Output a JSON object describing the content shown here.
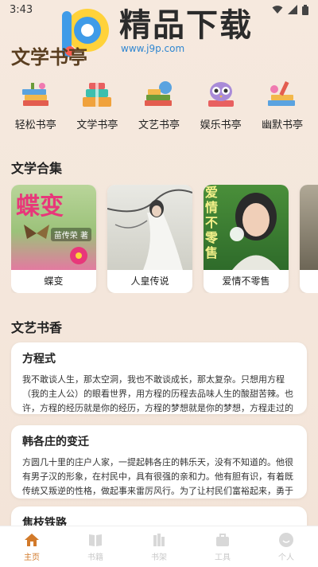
{
  "status": {
    "time": "3:43"
  },
  "watermark": {
    "title": "精品下载",
    "url": "www.j9p.com"
  },
  "page": {
    "title": "文学书亭"
  },
  "categories": [
    {
      "label": "轻松书亭",
      "icon": "books-stack-icon"
    },
    {
      "label": "文学书亭",
      "icon": "book-bundle-icon"
    },
    {
      "label": "文艺书亭",
      "icon": "globe-books-icon"
    },
    {
      "label": "娱乐书亭",
      "icon": "owl-books-icon"
    },
    {
      "label": "幽默书亭",
      "icon": "pencil-books-icon"
    }
  ],
  "sections": {
    "collection_title": "文学合集",
    "articles_title": "文艺书香"
  },
  "books": [
    {
      "name": "蝶变",
      "cover_title": "蝶变",
      "cover_author": "苗传荣 著"
    },
    {
      "name": "人皇传说"
    },
    {
      "name": "爱情不零售",
      "cover_text": "爱情不零售"
    },
    {
      "name": ""
    }
  ],
  "articles": [
    {
      "title": "方程式",
      "body": "我不敢谈人生，那太空洞，我也不敢谈成长，那太复杂。只想用方程（我的主人公）的眼看世界，用方程的历程去品味人生的酸甜苦辣。也许，方程的经历就是你的经历，方程的梦想就是你的梦想，方程走过的路正是你"
    },
    {
      "title": "韩各庄的变迁",
      "body": "方圆几十里的庄户人家，一提起韩各庄的韩乐天，没有不知道的。他很有男子汉的形象，在村民中，具有很强的亲和力。他有胆有识，有着既传统又叛逆的性格，做起事来雷厉风行。为了让村民们富裕起来，勇于承担责"
    },
    {
      "title": "焦枝铁路",
      "body": ""
    }
  ],
  "tabbar": [
    {
      "label": "主页",
      "icon": "home-icon",
      "active": true
    },
    {
      "label": "书籍",
      "icon": "book-icon",
      "active": false
    },
    {
      "label": "书架",
      "icon": "bookshelf-icon",
      "active": false
    },
    {
      "label": "工具",
      "icon": "briefcase-icon",
      "active": false
    },
    {
      "label": "个人",
      "icon": "profile-icon",
      "active": false
    }
  ],
  "colors": {
    "accent": "#d27a2a",
    "background": "#f4e7dc",
    "card": "#ffffff"
  }
}
